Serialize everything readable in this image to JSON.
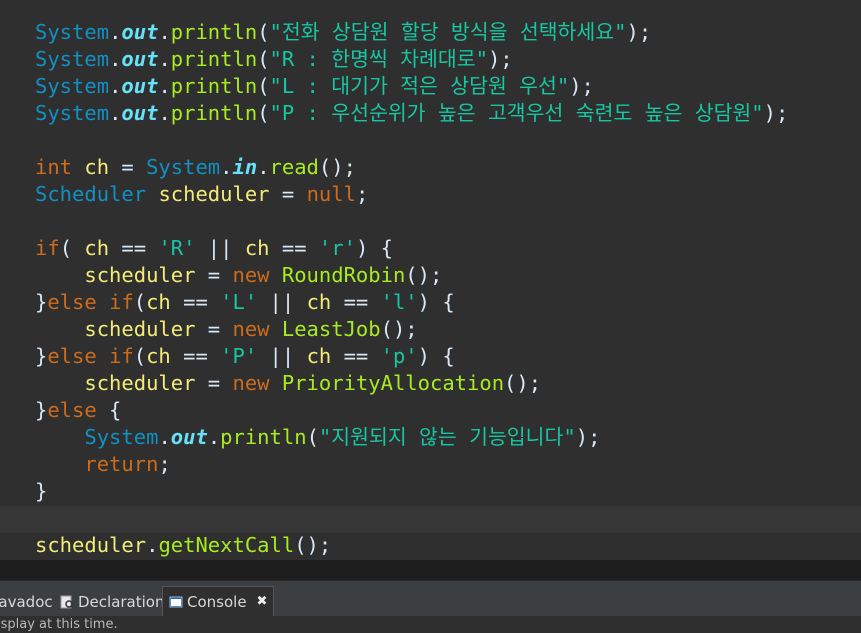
{
  "code": {
    "l1": {
      "cls": "System",
      "dot1": ".",
      "fld": "out",
      "dot2": ".",
      "mth": "println",
      "open": "(",
      "str": "\"전화 상담원 할당 방식을 선택하세요\"",
      "close": ");"
    },
    "l2": {
      "cls": "System",
      "dot1": ".",
      "fld": "out",
      "dot2": ".",
      "mth": "println",
      "open": "(",
      "str": "\"R : 한명씩 차례대로\"",
      "close": ");"
    },
    "l3": {
      "cls": "System",
      "dot1": ".",
      "fld": "out",
      "dot2": ".",
      "mth": "println",
      "open": "(",
      "str": "\"L : 대기가 적은 상담원 우선\"",
      "close": ");"
    },
    "l4": {
      "cls": "System",
      "dot1": ".",
      "fld": "out",
      "dot2": ".",
      "mth": "println",
      "open": "(",
      "str": "\"P : 우선순위가 높은 고객우선 숙련도 높은 상담원\"",
      "close": ");"
    },
    "l6": {
      "kw": "int",
      "sp1": " ",
      "var": "ch",
      "rest1": " = ",
      "cls": "System",
      "dot": ".",
      "fld": "in",
      "dot2": ".",
      "mth": "read",
      "end": "();"
    },
    "l7": {
      "cls": "Scheduler",
      "sp": " ",
      "var": "scheduler",
      "eq": " = ",
      "kw": "null",
      "end": ";"
    },
    "l9": {
      "kw": "if",
      "p1": "( ",
      "v1": "ch",
      "o1": " == ",
      "s1": "'R'",
      "o2": " || ",
      "v2": "ch",
      "o3": " == ",
      "s2": "'r'",
      "p2": ") {"
    },
    "l10": {
      "ind": "    ",
      "var": "scheduler",
      "eq": " = ",
      "kw": "new",
      "sp": " ",
      "cls": "RoundRobin",
      "end": "();"
    },
    "l11": {
      "b": "}",
      "kw1": "else",
      "sp": " ",
      "kw2": "if",
      "p1": "(",
      "v1": "ch",
      "o1": " == ",
      "s1": "'L'",
      "o2": " || ",
      "v2": "ch",
      "o3": " == ",
      "s2": "'l'",
      "p2": ") {"
    },
    "l12": {
      "ind": "    ",
      "var": "scheduler",
      "eq": " = ",
      "kw": "new",
      "sp": " ",
      "cls": "LeastJob",
      "end": "();"
    },
    "l13": {
      "b": "}",
      "kw1": "else",
      "sp": " ",
      "kw2": "if",
      "p1": "(",
      "v1": "ch",
      "o1": " == ",
      "s1": "'P'",
      "o2": " || ",
      "v2": "ch",
      "o3": " == ",
      "s2": "'p'",
      "p2": ") {"
    },
    "l14": {
      "ind": "    ",
      "var": "scheduler",
      "eq": " = ",
      "kw": "new",
      "sp": " ",
      "cls": "PriorityAllocation",
      "end": "();"
    },
    "l15": {
      "b": "}",
      "kw": "else",
      "end": " {"
    },
    "l16": {
      "ind": "    ",
      "cls": "System",
      "dot1": ".",
      "fld": "out",
      "dot2": ".",
      "mth": "println",
      "open": "(",
      "str": "\"지원되지 않는 기능입니다\"",
      "close": ");"
    },
    "l17": {
      "ind": "    ",
      "kw": "return",
      "end": ";"
    },
    "l18": {
      "b": "}"
    },
    "l20": {
      "var": "scheduler",
      "dot": ".",
      "mth": "getNextCall",
      "end": "();"
    }
  },
  "tabs": {
    "javadoc": "Javadoc",
    "declaration": "Declaration",
    "console": "Console",
    "close": "✖"
  },
  "status": "Display at this time."
}
